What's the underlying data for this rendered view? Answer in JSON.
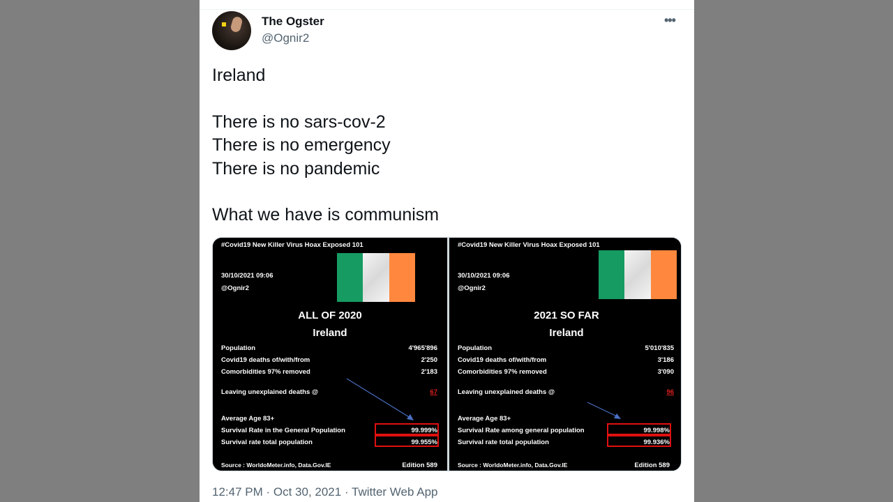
{
  "tweet": {
    "author_name": "The Ogster",
    "author_handle": "@Ognir2",
    "more_icon": "more-icon",
    "text": "Ireland\n\nThere is no sars-cov-2\nThere is no emergency\nThere is no pandemic\n\nWhat we have is communism",
    "timestamp": "12:47 PM · Oct 30, 2021 · Twitter Web App"
  },
  "image": {
    "panels": [
      {
        "header": "#Covid19 New Killer Virus Hoax Exposed 101",
        "date": "30/10/2021 09:06",
        "handle": "@Ognir2",
        "title": "ALL OF 2020",
        "country": "Ireland",
        "population_label": "Population",
        "population_value": "4'965'896",
        "deaths_label": "Covid19 deaths of/with/from",
        "deaths_value": "2'250",
        "comorb_label": "Comorbidities 97% removed",
        "comorb_value": "2'183",
        "unexplained_label": "Leaving unexplained deaths @",
        "unexplained_value": "67",
        "avg_age_label": "Average Age 83+",
        "survival_general_label": "Survival Rate in the General Population",
        "survival_general_value": "99.999%",
        "survival_total_label": "Survival rate total population",
        "survival_total_value": "99.955%",
        "source": "Source : WorldoMeter.info, Data.Gov.IE",
        "edition": "Edition 589"
      },
      {
        "header": "#Covid19 New Killer Virus Hoax Exposed 101",
        "date": "30/10/2021 09:06",
        "handle": "@Ognir2",
        "title": "2021 SO FAR",
        "country": "Ireland",
        "population_label": "Population",
        "population_value": "5'010'835",
        "deaths_label": "Covid19 deaths of/with/from",
        "deaths_value": "3'186",
        "comorb_label": "Comorbidities 97% removed",
        "comorb_value": "3'090",
        "unexplained_label": "Leaving unexplained deaths @",
        "unexplained_value": "96",
        "avg_age_label": "Average Age 83+",
        "survival_general_label": "Survival Rate among general population",
        "survival_general_value": "99.998%",
        "survival_total_label": "Survival rate total population",
        "survival_total_value": "99.936%",
        "source": "Source : WorldoMeter.info, Data.Gov.IE",
        "edition": "Edition 589"
      }
    ],
    "flag_colors": {
      "green": "#169b62",
      "white": "#f4f4f4",
      "orange": "#ff883e"
    },
    "highlight_color": "#e01010",
    "arrow_color": "#4a6fc4"
  }
}
